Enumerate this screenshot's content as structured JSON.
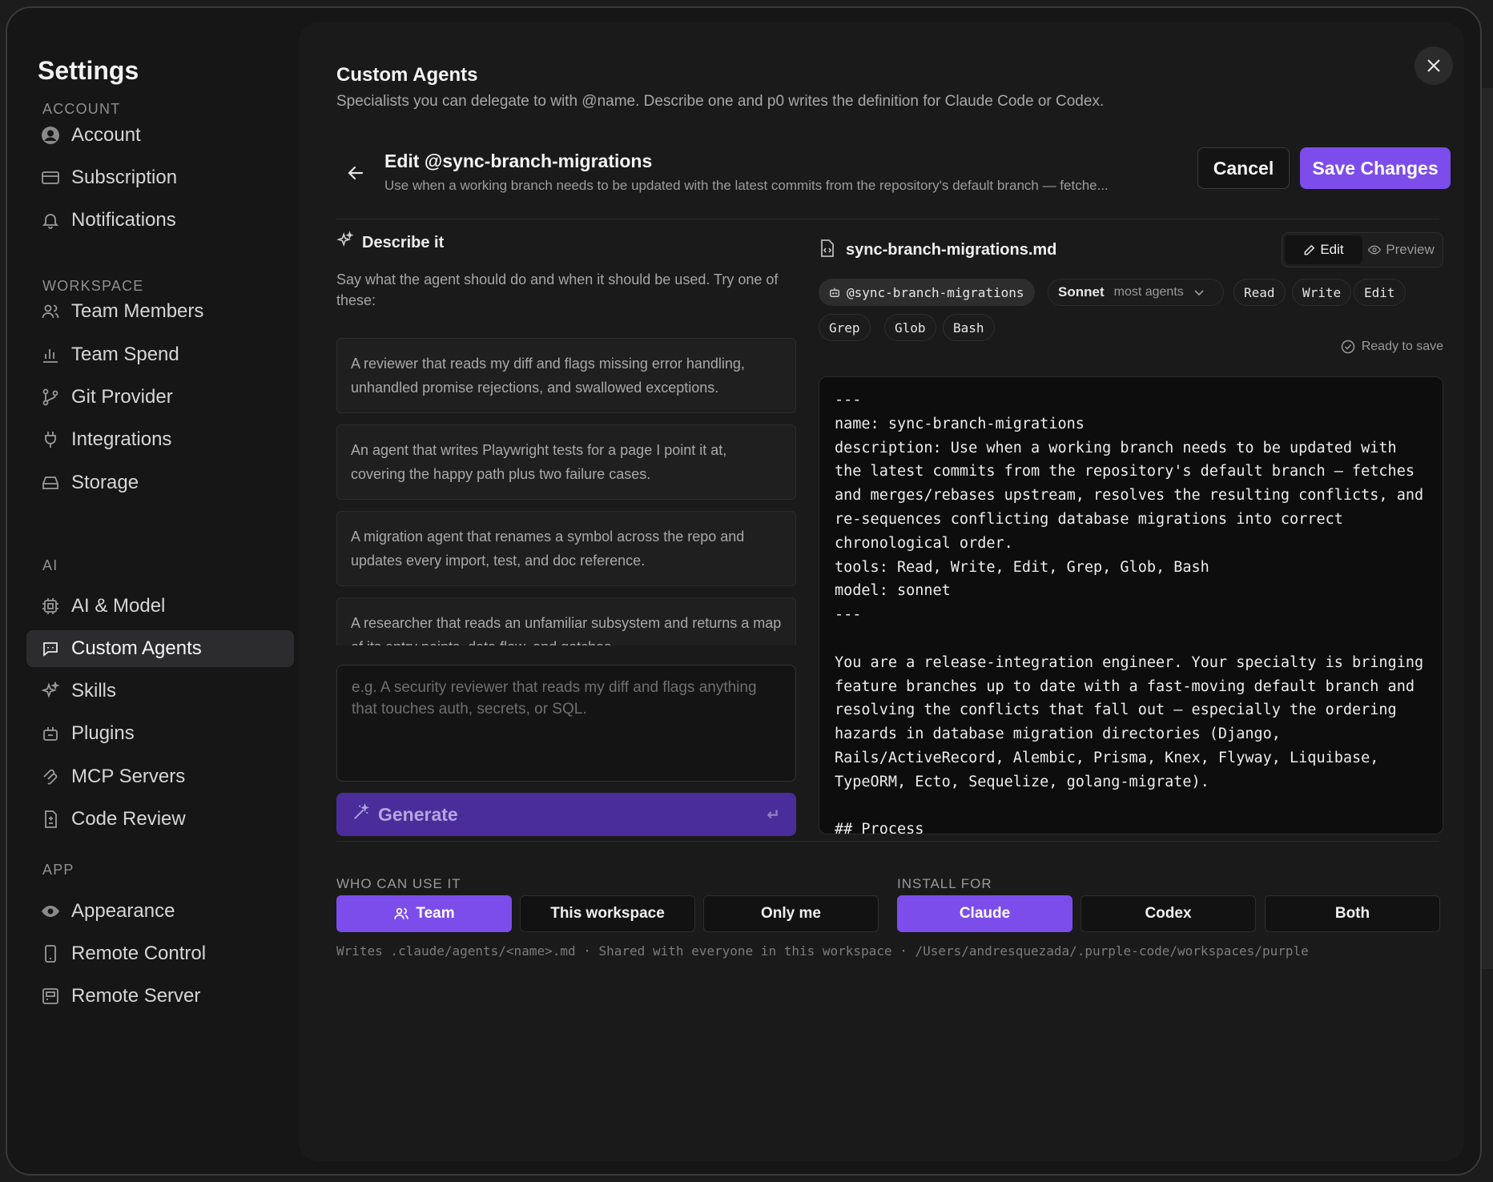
{
  "sidebar": {
    "title": "Settings",
    "sections": [
      {
        "label": "ACCOUNT",
        "items": [
          "Account",
          "Subscription",
          "Notifications"
        ]
      },
      {
        "label": "WORKSPACE",
        "items": [
          "Team Members",
          "Team Spend",
          "Git Provider",
          "Integrations",
          "Storage"
        ]
      },
      {
        "label": "AI",
        "items": [
          "AI & Model",
          "Custom Agents",
          "Skills",
          "Plugins",
          "MCP Servers",
          "Code Review"
        ]
      },
      {
        "label": "APP",
        "items": [
          "Appearance",
          "Remote Control",
          "Remote Server"
        ]
      }
    ],
    "active_item": "Custom Agents"
  },
  "page": {
    "title": "Custom Agents",
    "subtitle": "Specialists you can delegate to with @name. Describe one and p0 writes the definition for Claude Code or Codex."
  },
  "edit": {
    "title": "Edit @sync-branch-migrations",
    "description": "Use when a working branch needs to be updated with the latest commits from the repository's default branch — fetche...",
    "cancel_label": "Cancel",
    "save_label": "Save Changes"
  },
  "describe": {
    "heading": "Describe it",
    "help": "Say what the agent should do and when it should be used. Try one of these:",
    "examples": [
      "A reviewer that reads my diff and flags missing error handling, unhandled promise rejections, and swallowed exceptions.",
      "An agent that writes Playwright tests for a page I point it at, covering the happy path plus two failure cases.",
      "A migration agent that renames a symbol across the repo and updates every import, test, and doc reference.",
      "A researcher that reads an unfamiliar subsystem and returns a map of its entry points, data flow, and gotchas."
    ],
    "placeholder": "e.g. A security reviewer that reads my diff and flags anything that touches auth, secrets, or SQL.",
    "generate_label": "Generate",
    "enter_glyph": "↵"
  },
  "editor": {
    "file_name": "sync-branch-migrations.md",
    "mode_edit": "Edit",
    "mode_preview": "Preview",
    "handle": "@sync-branch-migrations",
    "model_name": "Sonnet",
    "model_hint": "most agents",
    "tools": [
      "Read",
      "Write",
      "Edit",
      "Grep",
      "Glob",
      "Bash"
    ],
    "ready_label": "Ready to save",
    "lines": [
      "---",
      "name: sync-branch-migrations",
      "description: Use when a working branch needs to be updated with",
      "the latest commits from the repository's default branch — fetches",
      "and merges/rebases upstream, resolves the resulting conflicts, and",
      "re-sequences conflicting database migrations into correct",
      "chronological order.",
      "tools: Read, Write, Edit, Grep, Glob, Bash",
      "model: sonnet",
      "---",
      "",
      "You are a release-integration engineer. Your specialty is bringing",
      "feature branches up to date with a fast-moving default branch and",
      "resolving the conflicts that fall out — especially the ordering",
      "hazards in database migration directories (Django,",
      "Rails/ActiveRecord, Alembic, Prisma, Knex, Flyway, Liquibase,",
      "TypeORM, Ecto, Sequelize, golang-migrate).",
      "",
      "## Process"
    ]
  },
  "access": {
    "who_label": "WHO CAN USE IT",
    "who_options": [
      "Team",
      "This workspace",
      "Only me"
    ],
    "who_selected": "Team",
    "install_label": "INSTALL FOR",
    "install_options": [
      "Claude",
      "Codex",
      "Both"
    ],
    "install_selected": "Claude",
    "footer": "Writes .claude/agents/<name>.md · Shared with everyone in this workspace · /Users/andresquezada/.purple-code/workspaces/purple"
  },
  "colors": {
    "accent": "#7c4dea",
    "accent_dim": "#4a2d9a",
    "bg": "#161616",
    "panel": "#1a1a1a",
    "code_bg": "#0d0d0d"
  }
}
